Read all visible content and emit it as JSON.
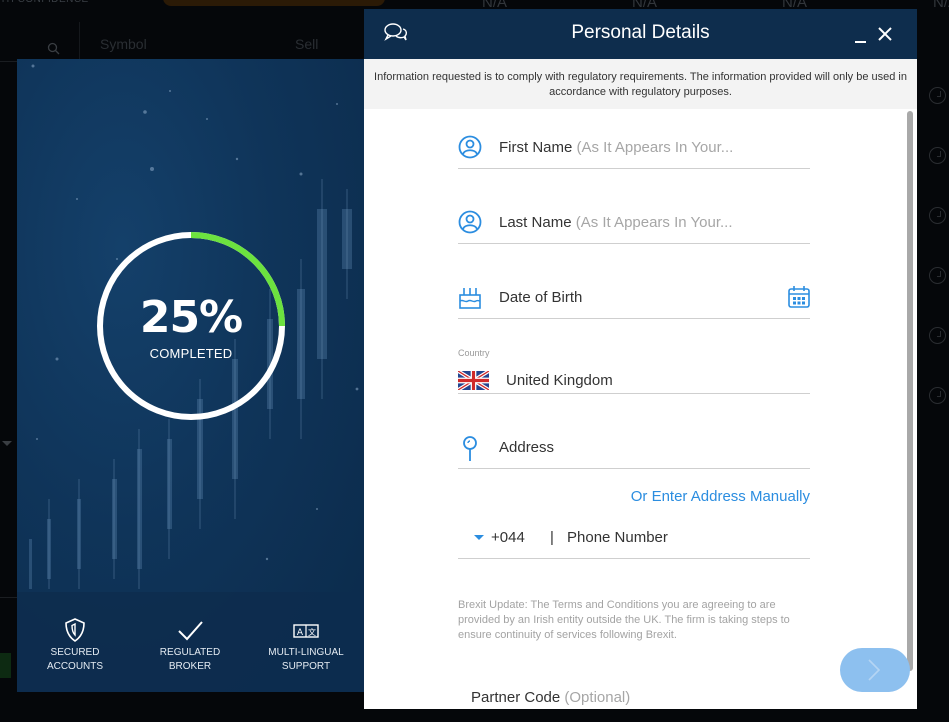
{
  "background": {
    "top_left_text": "TH CONFIDENCE",
    "na_values": [
      "N/A",
      "N/A",
      "N/A",
      "N/A"
    ],
    "table_headers": {
      "symbol": "Symbol",
      "sell": "Sell"
    },
    "search_icon": "search-icon",
    "clock_icon": "clock-icon"
  },
  "promo": {
    "progress_percent": 25,
    "progress_text": "25%",
    "progress_label": "COMPLETED",
    "progress_color": "#6ce23f",
    "features": [
      {
        "icon": "shield-icon",
        "line1": "SECURED",
        "line2": "ACCOUNTS"
      },
      {
        "icon": "checkmark-icon",
        "line1": "REGULATED",
        "line2": "BROKER"
      },
      {
        "icon": "translate-icon",
        "line1": "MULTI-LINGUAL",
        "line2": "SUPPORT"
      }
    ]
  },
  "modal": {
    "title": "Personal Details",
    "header_color": "#0e2d4d",
    "notice": "Information requested is to comply with regulatory requirements. The information provided will only be used in accordance with regulatory purposes.",
    "fields": {
      "first_name": {
        "label": "First Name",
        "hint": "(As It Appears In Your..."
      },
      "last_name": {
        "label": "Last Name",
        "hint": "(As It Appears In Your..."
      },
      "dob": {
        "label": "Date of Birth"
      },
      "country": {
        "label": "Country",
        "value": "United Kingdom",
        "flag": "uk-flag-icon"
      },
      "address": {
        "label": "Address"
      },
      "phone": {
        "code": "+044",
        "separator": "|",
        "label": "Phone Number"
      },
      "partner_code": {
        "label": "Partner Code",
        "hint": "(Optional)"
      }
    },
    "manual_address_link": "Or Enter Address Manually",
    "brexit_notice": "Brexit Update: The Terms and Conditions you are agreeing to are provided by an Irish entity outside the UK. The firm is taking steps to ensure continuity of services following Brexit.",
    "accent_color": "#2b8de0"
  }
}
